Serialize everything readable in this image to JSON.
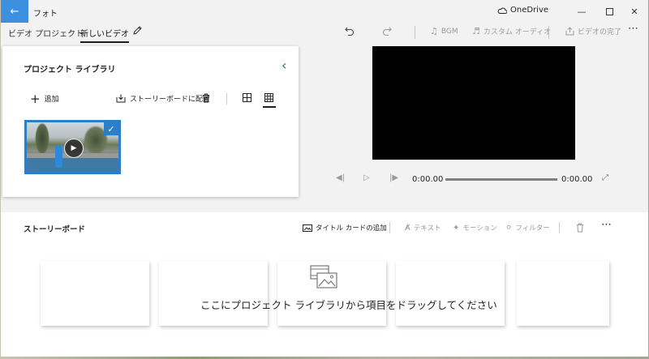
{
  "window": {
    "app_title": "フォト",
    "back_icon": "arrow-left-icon",
    "onedrive_label": "OneDrive",
    "onedrive_icon": "cloud-icon"
  },
  "toolbar": {
    "crumb_project": "ビデオ プロジェクト",
    "crumb_current": "新しいビデオ",
    "bgm_label": "BGM",
    "custom_audio_label": "カスタム オーディオ",
    "finish_label": "ビデオの完了"
  },
  "library": {
    "title": "プロジェクト ライブラリ",
    "add_label": "追加",
    "place_storyboard_label": "ストーリーボードに配置"
  },
  "player": {
    "current_time": "0:00.00",
    "total_time": "0:00.00"
  },
  "storyboard": {
    "title": "ストーリーボード",
    "title_card_label": "タイトル カードの追加",
    "text_label": "テキスト",
    "motion_label": "モーション",
    "filter_label": "フィルター",
    "empty_hint": "ここにプロジェクト ライブラリから項目をドラッグしてください"
  },
  "colors": {
    "accent": "#3d8fe0",
    "selection": "#2a7fc7",
    "collapse_chevron": "#1b6a8a",
    "preview_bg": "#000000"
  }
}
